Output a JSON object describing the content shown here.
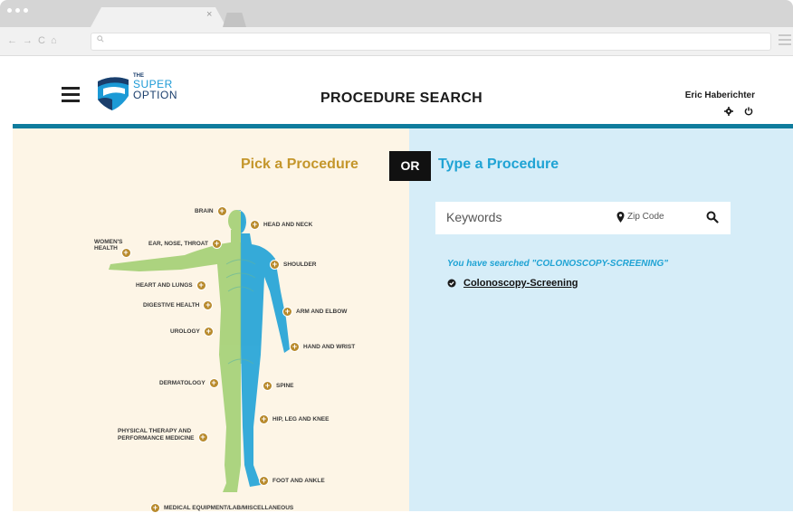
{
  "browser": {
    "tab_close": "×",
    "nav_back": "←",
    "nav_forward": "→",
    "nav_reload": "C",
    "nav_home": "⌂"
  },
  "header": {
    "logo": {
      "the": "THE",
      "super": "SUPER",
      "option": "OPTION"
    },
    "title": "PROCEDURE SEARCH",
    "user_name": "Eric Haberichter",
    "icons": [
      "gear-icon",
      "power-icon"
    ]
  },
  "picker": {
    "pick_label": "Pick a Procedure",
    "or_label": "OR",
    "type_label": "Type a Procedure"
  },
  "body_parts": {
    "brain": "BRAIN",
    "head_neck": "HEAD AND NECK",
    "womens_health_1": "WOMEN'S",
    "womens_health_2": "HEALTH",
    "ent": "EAR, NOSE, THROAT",
    "shoulder": "SHOULDER",
    "heart_lungs": "HEART AND LUNGS",
    "digestive": "DIGESTIVE HEALTH",
    "arm_elbow": "ARM AND ELBOW",
    "urology": "UROLOGY",
    "hand_wrist": "HAND AND WRIST",
    "dermatology": "DERMATOLOGY",
    "spine": "SPINE",
    "hip_leg_knee": "HIP, LEG AND KNEE",
    "pt_1": "PHYSICAL THERAPY AND",
    "pt_2": "PERFORMANCE MEDICINE",
    "foot_ankle": "FOOT AND ANKLE",
    "medical_equipment": "MEDICAL EQUIPMENT/LAB/MISCELLANEOUS"
  },
  "search": {
    "keywords_placeholder": "Keywords",
    "zip_placeholder": "Zip Code",
    "searched_message": "You have searched \"COLONOSCOPY-SCREENING\"",
    "results": [
      "Colonoscopy-Screening"
    ]
  },
  "colors": {
    "gold": "#c4962b",
    "blue": "#1fa3d4",
    "header_rule": "#0f7c9d",
    "left_bg": "#fdf5e6",
    "right_bg": "#d6edf8"
  }
}
